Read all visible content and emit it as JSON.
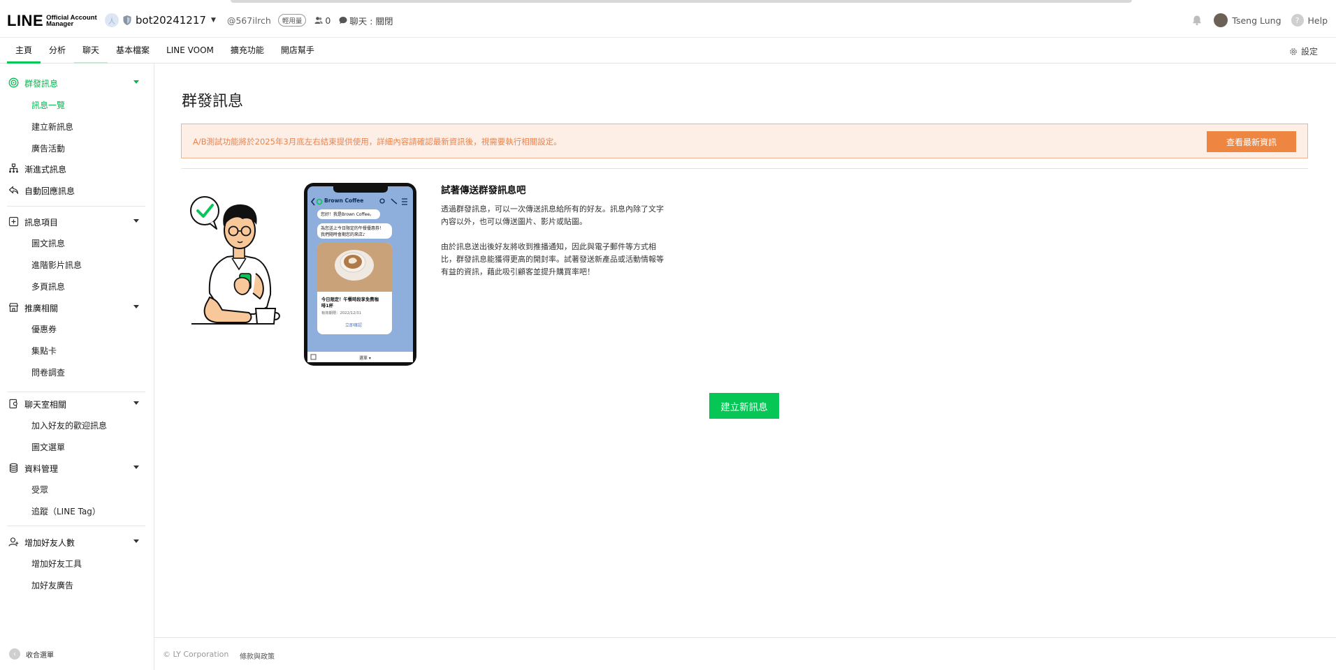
{
  "header": {
    "logo_main": "LINE",
    "logo_sub_1": "Official Account",
    "logo_sub_2": "Manager",
    "account_avatar": "人",
    "bot_name": "bot20241217",
    "bot_id": "@567ilrch",
    "plan_badge": "輕用量",
    "friends_count": "0",
    "chat_status": "聊天 : 關閉",
    "user_name": "Tseng Lung",
    "help_label": "Help",
    "help_icon": "?"
  },
  "nav": {
    "tabs": [
      {
        "label": "主頁"
      },
      {
        "label": "分析"
      },
      {
        "label": "聊天"
      },
      {
        "label": "基本檔案"
      },
      {
        "label": "LINE VOOM"
      },
      {
        "label": "擴充功能"
      },
      {
        "label": "開店幫手"
      }
    ],
    "settings_label": "設定"
  },
  "sidebar": {
    "broadcast": "群發訊息",
    "broadcast_items": [
      "訊息一覽",
      "建立新訊息",
      "廣告活動"
    ],
    "step_messages": "漸進式訊息",
    "auto_reply": "自動回應訊息",
    "message_items": "訊息項目",
    "message_items_list": [
      "圖文訊息",
      "進階影片訊息",
      "多頁訊息"
    ],
    "promotion": "推廣相關",
    "promotion_items": [
      "優惠券",
      "集點卡",
      "問卷調查"
    ],
    "chatroom": "聊天室相關",
    "chatroom_items": [
      "加入好友的歡迎訊息",
      "圖文選單"
    ],
    "data_mgmt": "資料管理",
    "data_mgmt_items": [
      "受眾",
      "追蹤（LINE Tag）"
    ],
    "grow_friends": "增加好友人數",
    "grow_friends_items": [
      "增加好友工具",
      "加好友廣告"
    ],
    "collapse_label": "收合選單",
    "collapse_icon": "‹"
  },
  "main": {
    "title": "群發訊息",
    "notice_text": "A/B測試功能將於2025年3月底左右結束提供使用，詳細內容請確認最新資訊後，視需要執行相關設定。",
    "notice_button": "查看最新資訊",
    "intro_title": "試著傳送群發訊息吧",
    "intro_p1_line1": "透過群發訊息，可以一次傳送訊息給所有的好友。訊息內除了文字",
    "intro_p1_line2": "內容以外，也可以傳送圖片、影片或貼圖。",
    "intro_p2_line1": "由於訊息送出後好友將收到推播通知，因此與電子郵件等方式相",
    "intro_p2_line2": "比，群發訊息能獲得更高的開封率。試著發送新產品或活動情報等",
    "intro_p2_line3": "有益的資訊，藉此吸引顧客並提升購買率吧！",
    "create_button": "建立新訊息"
  },
  "phone": {
    "chat_name": "Brown Coffee",
    "bubble1": "您好！我是Brown Coffee。",
    "bubble2_line1": "為您送上今日限定的午餐優惠券！",
    "bubble2_line2": "我們隨時會期您的來店♪",
    "card_title_line1": "今日限定！午餐時段享免費咖",
    "card_title_line2": "啡1杯",
    "card_expiry": "有效期限：2022/12/31",
    "card_link": "立即確認",
    "menu_label": "選單 ▾"
  },
  "footer": {
    "copyright": "© LY Corporation",
    "terms": "條款與政策"
  },
  "colors": {
    "line_green": "#06c755",
    "notice_orange": "#ee8642",
    "notice_bg": "#fdeee6"
  }
}
